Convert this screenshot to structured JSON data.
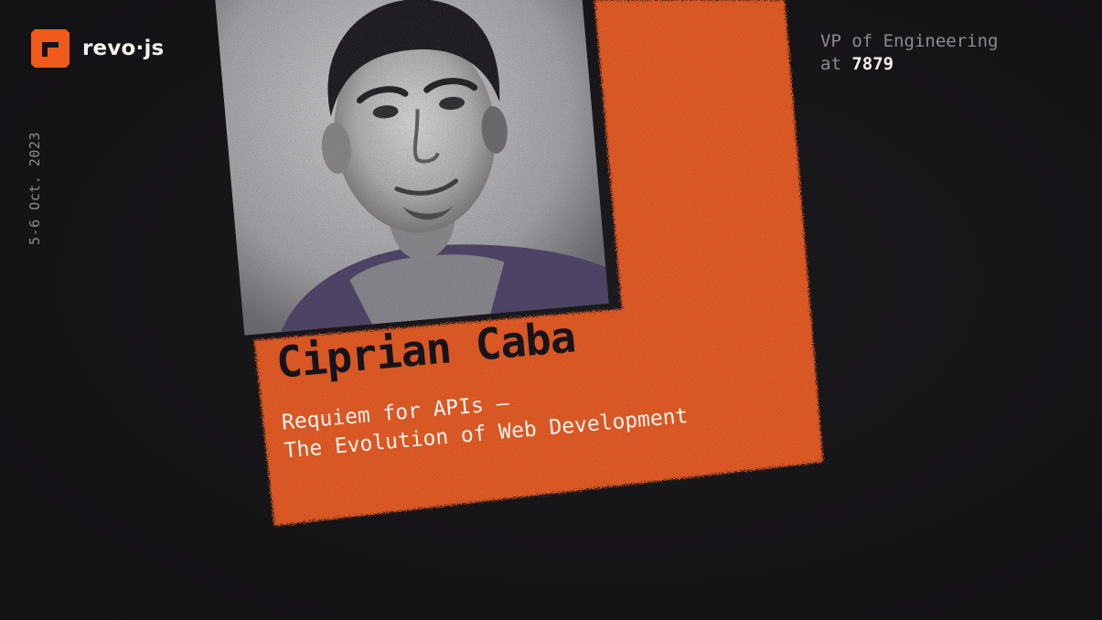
{
  "brand": {
    "logo_text": "revo·js",
    "accent": "#f05a1a"
  },
  "event": {
    "date": "5-6 Oct. 2023"
  },
  "speaker": {
    "role_line": "VP of Engineering",
    "at_word": "at",
    "company": "7879",
    "name": "Ciprian Caba"
  },
  "talk": {
    "title_line1": "Requiem for APIs —",
    "title_line2": "The Evolution of Web Development"
  },
  "icons": {
    "logo": "revojs-logo-icon"
  },
  "colors": {
    "background": "#151417",
    "orange": "#f05a1a",
    "text_light": "#f4f2ee",
    "text_muted": "#8c8b92"
  }
}
